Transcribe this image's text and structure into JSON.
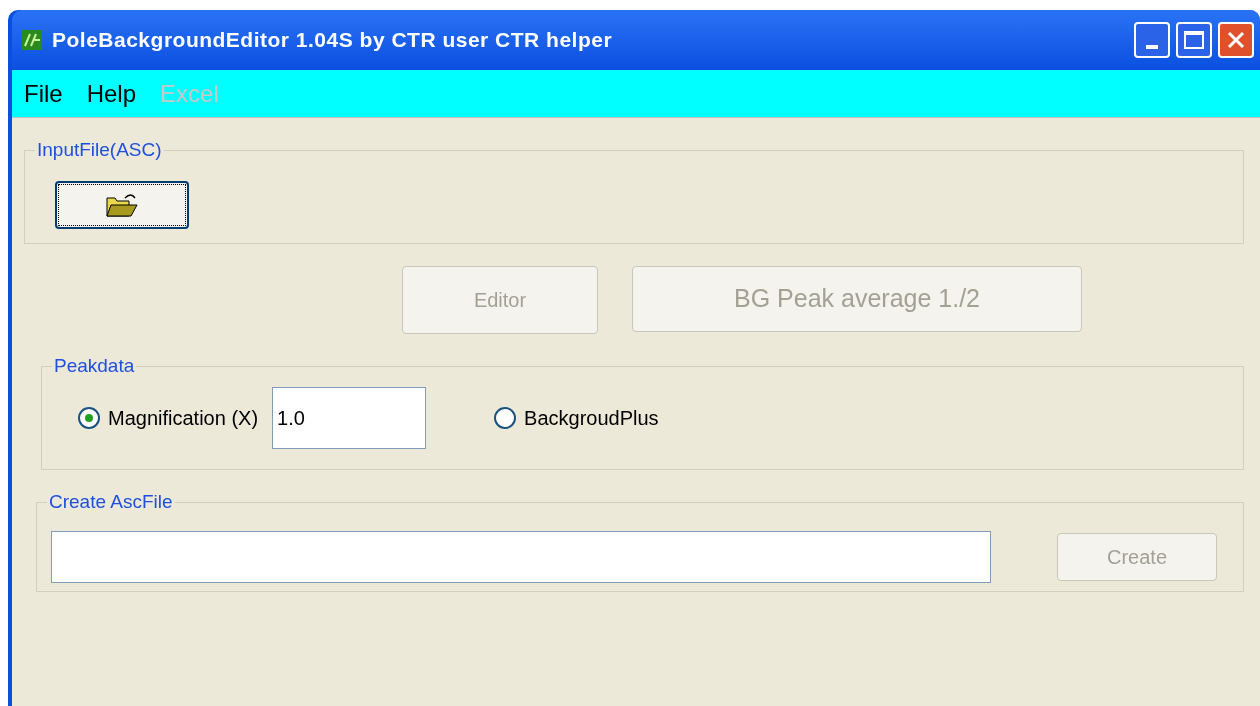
{
  "window": {
    "title": "PoleBackgroundEditor 1.04S by CTR user CTR helper"
  },
  "menu": [
    {
      "label": "File",
      "disabled": false
    },
    {
      "label": "Help",
      "disabled": false
    },
    {
      "label": "Excel",
      "disabled": true
    }
  ],
  "input_group": {
    "title": "InputFile(ASC)"
  },
  "actions": [
    {
      "label": "Editor",
      "disabled": true
    },
    {
      "label": "BG Peak average 1./2",
      "disabled": true
    }
  ],
  "peakdata": {
    "title": "Peakdata",
    "options": [
      {
        "label": "Magnification (X)",
        "selected": true
      },
      {
        "label": "BackgroudPlus",
        "selected": false
      }
    ],
    "magnification": {
      "value": "1.0"
    }
  },
  "create_group": {
    "title": "Create AscFile",
    "create_button": {
      "label": "Create",
      "disabled": true
    }
  }
}
